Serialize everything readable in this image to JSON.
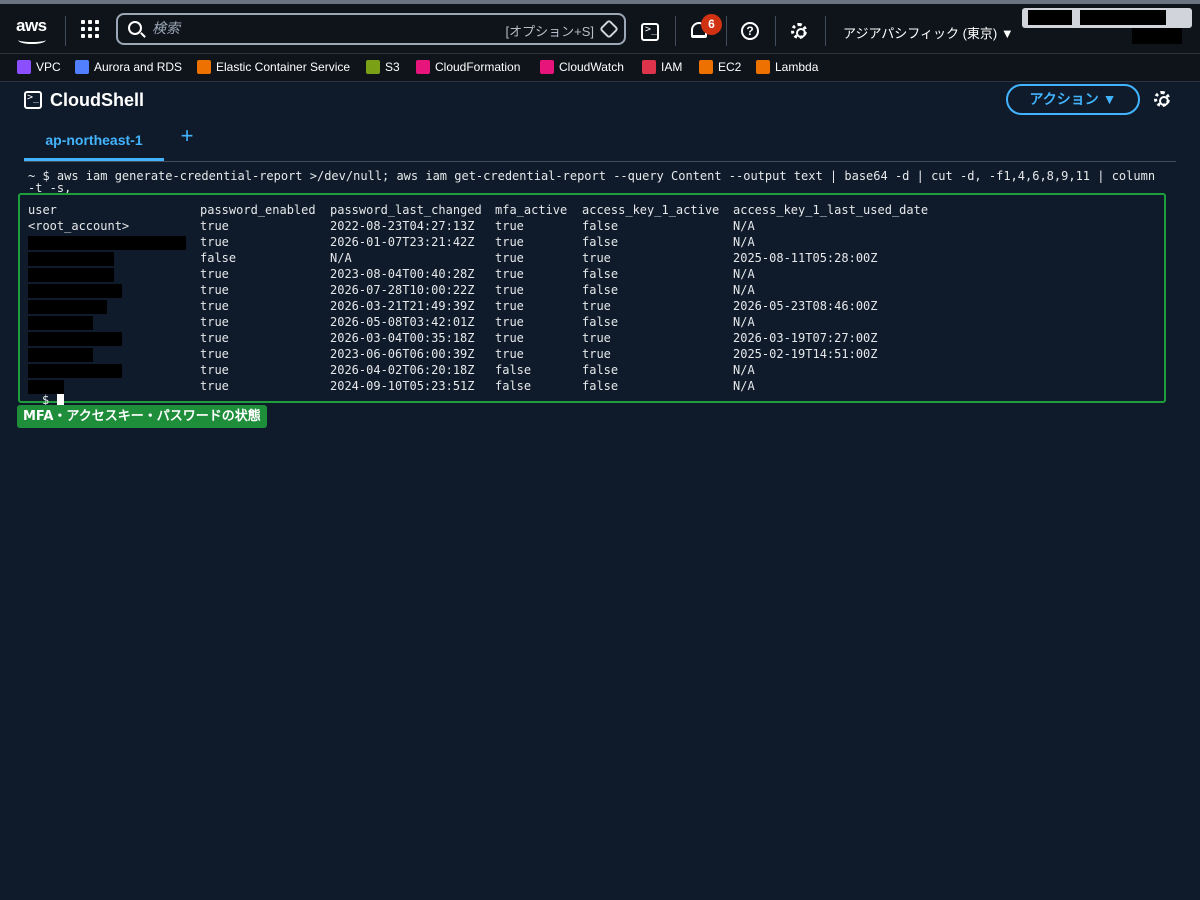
{
  "topbar": {
    "logo": "aws",
    "search": {
      "placeholder": "検索",
      "shortcut": "[オプション+S]"
    },
    "notifications_count": "6",
    "help_label": "?",
    "region": "アジアパシフィック (東京) ▼"
  },
  "favorites": [
    {
      "label": "VPC",
      "color": "#8c4fff"
    },
    {
      "label": "Aurora and RDS",
      "color": "#527fff"
    },
    {
      "label": "Elastic Container Service",
      "color": "#ed7100"
    },
    {
      "label": "S3",
      "color": "#7aa116"
    },
    {
      "label": "CloudFormation",
      "color": "#e7157b"
    },
    {
      "label": "CloudWatch",
      "color": "#e7157b"
    },
    {
      "label": "IAM",
      "color": "#dd344c"
    },
    {
      "label": "EC2",
      "color": "#ed7100"
    },
    {
      "label": "Lambda",
      "color": "#ed7100"
    }
  ],
  "page": {
    "title": "CloudShell",
    "action_button": "アクション ▼",
    "tab_label": "ap-northeast-1",
    "tab_add": "+"
  },
  "terminal": {
    "command": "~ $ aws iam generate-credential-report >/dev/null; aws iam get-credential-report --query Content --output text | base64 -d | cut -d, -f1,4,6,8,9,11 | column -t -s,",
    "headers": [
      "user",
      "password_enabled",
      "password_last_changed",
      "mfa_active",
      "access_key_1_active",
      "access_key_1_last_used_date"
    ],
    "rows": [
      [
        "<root_account>",
        "true",
        "2022-08-23T04:27:13Z",
        "true",
        "false",
        "N/A"
      ],
      [
        "",
        "true",
        "2026-01-07T23:21:42Z",
        "true",
        "false",
        "N/A"
      ],
      [
        "",
        "false",
        "N/A",
        "true",
        "true",
        "2025-08-11T05:28:00Z"
      ],
      [
        "",
        "true",
        "2023-08-04T00:40:28Z",
        "true",
        "false",
        "N/A"
      ],
      [
        "",
        "true",
        "2026-07-28T10:00:22Z",
        "true",
        "false",
        "N/A"
      ],
      [
        "",
        "true",
        "2026-03-21T21:49:39Z",
        "true",
        "true",
        "2026-05-23T08:46:00Z"
      ],
      [
        "",
        "true",
        "2026-05-08T03:42:01Z",
        "true",
        "false",
        "N/A"
      ],
      [
        "",
        "true",
        "2026-03-04T00:35:18Z",
        "true",
        "true",
        "2026-03-19T07:27:00Z"
      ],
      [
        "",
        "true",
        "2023-06-06T06:00:39Z",
        "true",
        "true",
        "2025-02-19T14:51:00Z"
      ],
      [
        "",
        "true",
        "2026-04-02T06:20:18Z",
        "false",
        "false",
        "N/A"
      ],
      [
        "",
        "true",
        "2024-09-10T05:23:51Z",
        "false",
        "false",
        "N/A"
      ]
    ],
    "prompt": "$"
  },
  "annotation": "MFA・アクセスキー・パスワードの状態",
  "colors": {
    "accent": "#42b4ff",
    "badge": "#d13212",
    "highlight": "#1e9e3a"
  }
}
